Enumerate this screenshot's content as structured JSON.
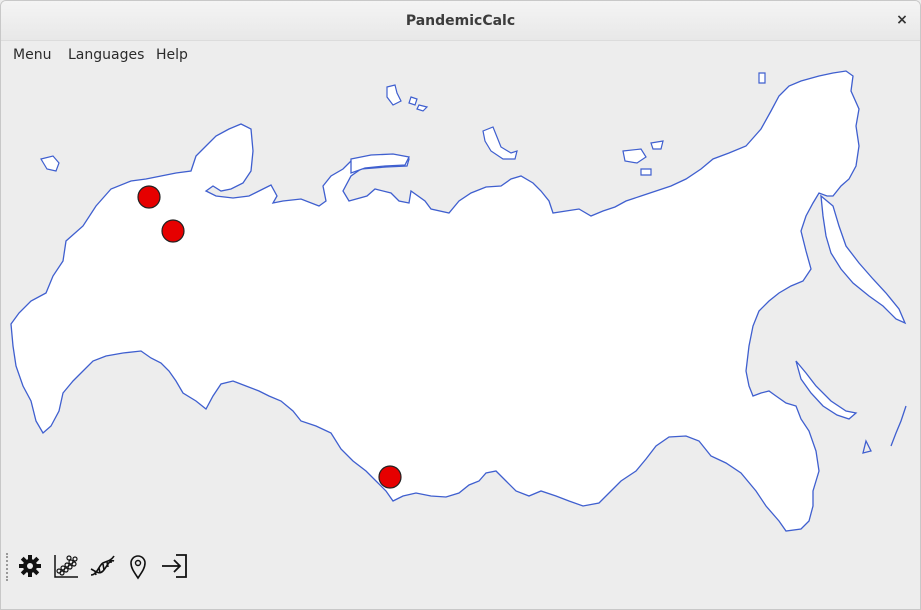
{
  "window": {
    "title": "PandemicCalc",
    "close_glyph": "×"
  },
  "menubar": {
    "items": [
      "Menu",
      "Languages",
      "Help"
    ]
  },
  "map": {
    "region": "Russia outline",
    "fill_color": "#ffffff",
    "outline_color": "#3f5fcf",
    "markers": [
      {
        "name": "outbreak-marker-1",
        "color": "#e60000"
      },
      {
        "name": "outbreak-marker-2",
        "color": "#e60000"
      },
      {
        "name": "outbreak-marker-3",
        "color": "#e60000"
      }
    ]
  },
  "toolbar": {
    "tools": [
      {
        "icon": "gear-icon"
      },
      {
        "icon": "scatter-chart-icon"
      },
      {
        "icon": "dna-icon"
      },
      {
        "icon": "location-pin-icon"
      },
      {
        "icon": "exit-icon"
      }
    ]
  }
}
